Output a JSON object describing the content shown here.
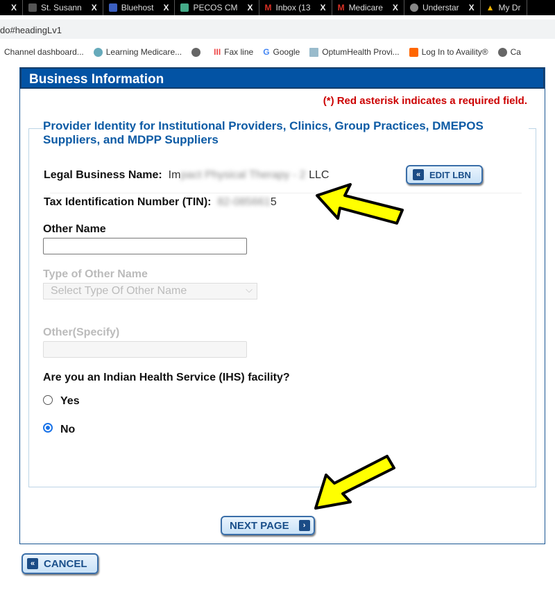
{
  "browser": {
    "tabs": [
      {
        "label": "",
        "icon": "close-icon"
      },
      {
        "label": "St. Susann",
        "color": "#777"
      },
      {
        "label": "Bluehost",
        "color": "#3b5fc0"
      },
      {
        "label": "PECOS CM",
        "color": "#4a8"
      },
      {
        "label": "Inbox (13",
        "color": "#d93025"
      },
      {
        "label": "Medicare",
        "color": "#d93025"
      },
      {
        "label": "Understar",
        "color": "#888"
      },
      {
        "label": "My Dr",
        "color": "#f4b400"
      }
    ],
    "address": "do#headingLv1",
    "bookmarks": [
      "Channel dashboard...",
      "Learning Medicare...",
      "",
      "Fax line",
      "Google",
      "OptumHealth Provi...",
      "Log In to Availity®",
      "Ca"
    ]
  },
  "panel": {
    "title": "Business Information",
    "required_note": "(*) Red asterisk indicates a required field.",
    "section_title": "Provider Identity for Institutional Providers, Clinics, Group Practices, DMEPOS Suppliers, and MDPP Suppliers",
    "lbn_label": "Legal Business Name:",
    "lbn_value": {
      "start": "Im",
      "hidden": "pact Physical Therapy - 2",
      "end": " LLC"
    },
    "edit_lbn": "EDIT LBN",
    "tin_label": "Tax Identification Number (TIN):",
    "tin_value": {
      "hidden": "82-085661",
      "end": "5"
    },
    "other_name_label": "Other Name",
    "other_name_value": "",
    "type_label": "Type of Other Name",
    "type_placeholder": "Select Type Of Other Name",
    "specify_label": "Other(Specify)",
    "specify_value": "",
    "ihs_question": "Are you an Indian Health Service (IHS) facility?",
    "ihs_options": [
      {
        "label": "Yes",
        "selected": false
      },
      {
        "label": "No",
        "selected": true
      }
    ],
    "next_page": "NEXT PAGE"
  },
  "cancel": "CANCEL",
  "colors": {
    "header": "#0353a4",
    "required": "#cc0000",
    "section": "#0d5ba5",
    "arrow": "#ffff00"
  }
}
